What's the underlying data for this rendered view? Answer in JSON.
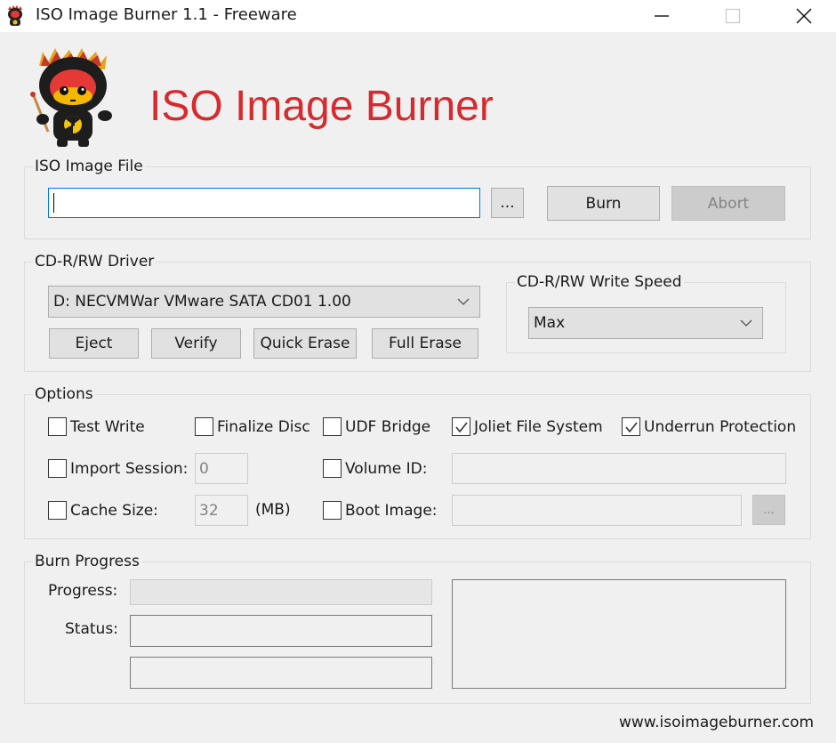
{
  "window": {
    "title": "ISO Image Burner 1.1 - Freeware",
    "controls": {
      "minimize": "minimize-icon",
      "maximize": "maximize-icon",
      "close": "close-icon"
    }
  },
  "header": {
    "brand_title": "ISO Image Burner",
    "brand_color": "#d52b2f"
  },
  "iso_file": {
    "group_label": "ISO Image File",
    "path_value": "",
    "browse_label": "...",
    "burn_label": "Burn",
    "abort_label": "Abort"
  },
  "driver": {
    "group_label": "CD-R/RW Driver",
    "selected_drive": "D: NECVMWar VMware SATA CD01 1.00",
    "eject_label": "Eject",
    "verify_label": "Verify",
    "quick_erase_label": "Quick Erase",
    "full_erase_label": "Full Erase"
  },
  "write_speed": {
    "group_label": "CD-R/RW Write Speed",
    "selected": "Max"
  },
  "options": {
    "group_label": "Options",
    "test_write": {
      "label": "Test Write",
      "checked": false
    },
    "finalize_disc": {
      "label": "Finalize Disc",
      "checked": false
    },
    "udf_bridge": {
      "label": "UDF Bridge",
      "checked": false
    },
    "joliet": {
      "label": "Joliet File System",
      "checked": true
    },
    "underrun": {
      "label": "Underrun Protection",
      "checked": true
    },
    "import_session": {
      "label": "Import Session:",
      "checked": false,
      "value": "0"
    },
    "volume_id": {
      "label": "Volume ID:",
      "checked": false,
      "value": ""
    },
    "cache_size": {
      "label": "Cache Size:",
      "checked": false,
      "value": "32",
      "unit": "(MB)"
    },
    "boot_image": {
      "label": "Boot Image:",
      "checked": false,
      "value": "",
      "browse_label": "..."
    }
  },
  "progress": {
    "group_label": "Burn Progress",
    "progress_label": "Progress:",
    "progress_value": 0,
    "status_label": "Status:",
    "status_value": "",
    "status_value_2": "",
    "log_text": ""
  },
  "footer": {
    "website": "www.isoimageburner.com"
  }
}
